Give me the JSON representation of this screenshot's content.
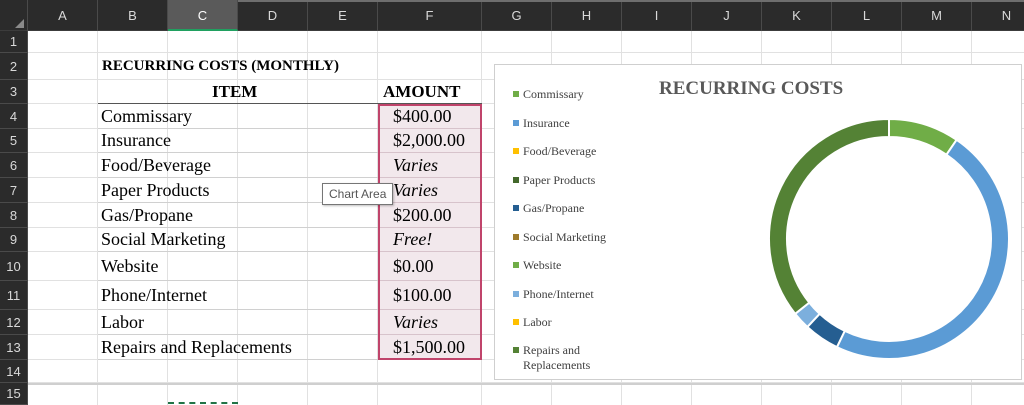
{
  "columns": [
    "A",
    "B",
    "C",
    "D",
    "E",
    "F",
    "G",
    "H",
    "I",
    "J",
    "K",
    "L",
    "M",
    "N"
  ],
  "selected_column": "C",
  "rows": [
    "1",
    "2",
    "3",
    "4",
    "5",
    "6",
    "7",
    "8",
    "9",
    "10",
    "11",
    "12",
    "13",
    "14",
    "15"
  ],
  "sheet": {
    "title": "RECURRING COSTS (MONTHLY)",
    "item_header": "ITEM",
    "amount_header": "AMOUNT",
    "items": [
      {
        "name": "Commissary",
        "amount": "$400.00"
      },
      {
        "name": "Insurance",
        "amount": "$2,000.00"
      },
      {
        "name": "Food/Beverage",
        "amount": "Varies"
      },
      {
        "name": "Paper Products",
        "amount": "Varies"
      },
      {
        "name": "Gas/Propane",
        "amount": "$200.00"
      },
      {
        "name": "Social Marketing",
        "amount": "Free!"
      },
      {
        "name": "Website",
        "amount": "$0.00"
      },
      {
        "name": "Phone/Internet",
        "amount": "$100.00"
      },
      {
        "name": "Labor",
        "amount": "Varies"
      },
      {
        "name": "Repairs and Replacements",
        "amount": "$1,500.00"
      }
    ]
  },
  "tooltip": "Chart Area",
  "chart_data": {
    "type": "pie",
    "title": "RECURRING COSTS",
    "legend_position": "left",
    "categories": [
      "Commissary",
      "Insurance",
      "Food/Beverage",
      "Paper Products",
      "Gas/Propane",
      "Social Marketing",
      "Website",
      "Phone/Internet",
      "Labor",
      "Repairs and Replacements"
    ],
    "values": [
      400,
      2000,
      0,
      0,
      200,
      0,
      0,
      100,
      0,
      1500
    ],
    "colors": [
      "#70ad47",
      "#5b9bd5",
      "#ffc000",
      "#43682b",
      "#255e91",
      "#9e7a2a",
      "#70ad47",
      "#7cafdd",
      "#ffc000",
      "#548235"
    ]
  }
}
